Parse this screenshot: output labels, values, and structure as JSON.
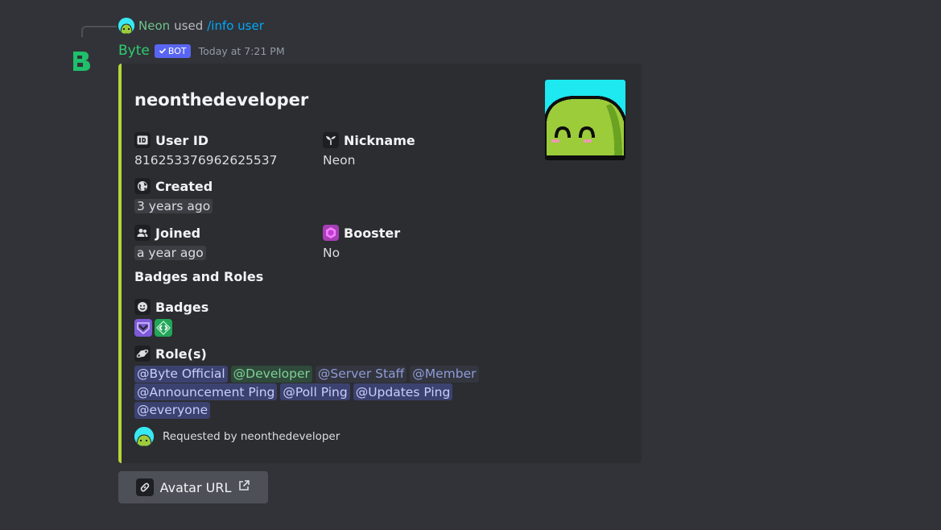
{
  "reply": {
    "user": "Neon",
    "used": "used",
    "command": "/info user"
  },
  "message": {
    "author": "Byte",
    "bot_tag": "BOT",
    "timestamp": "Today at 7:21 PM"
  },
  "embed": {
    "accent_color": "#b5d637",
    "title": "neonthedeveloper",
    "fields": {
      "user_id": {
        "name": "User ID",
        "value": "816253376962625537"
      },
      "nickname": {
        "name": "Nickname",
        "value": "Neon"
      },
      "created": {
        "name": "Created",
        "value": "3 years ago"
      },
      "joined": {
        "name": "Joined",
        "value": "a year ago"
      },
      "booster": {
        "name": "Booster",
        "value": "No"
      }
    },
    "section_title": "Badges and Roles",
    "badges_label": "Badges",
    "roles_label": "Role(s)",
    "roles": [
      [
        "@Byte Official",
        "@Developer",
        "@Server Staff",
        "@Member"
      ],
      [
        "@Announcement Ping",
        "@Poll Ping",
        "@Updates Ping"
      ],
      [
        "@everyone"
      ]
    ],
    "footer": "Requested by neonthedeveloper"
  },
  "button": {
    "label": "Avatar URL"
  }
}
